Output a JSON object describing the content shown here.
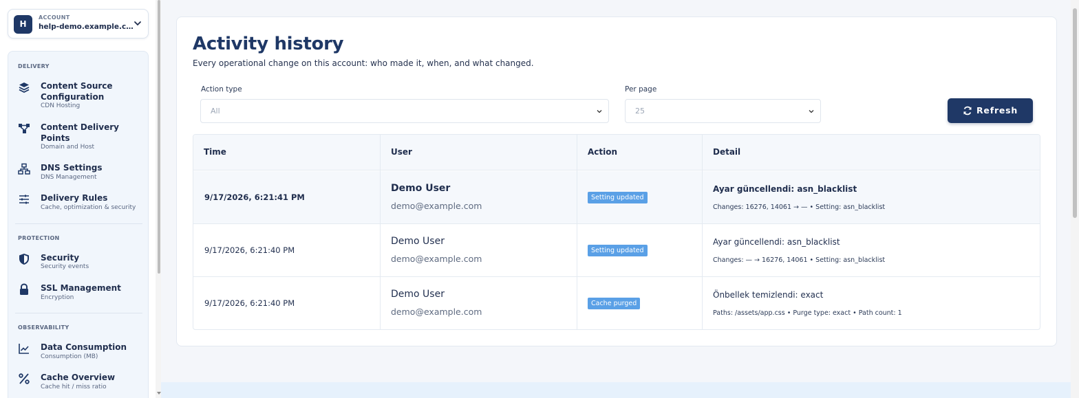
{
  "account": {
    "label": "ACCOUNT",
    "avatar_letter": "H",
    "name": "help-demo.example.c..."
  },
  "sidebar": {
    "sections": [
      {
        "title": "DELIVERY",
        "items": [
          {
            "label": "Content Source Configuration",
            "sub": "CDN Hosting",
            "icon": "layers-icon"
          },
          {
            "label": "Content Delivery Points",
            "sub": "Domain and Host",
            "icon": "network-nodes-icon"
          },
          {
            "label": "DNS Settings",
            "sub": "DNS Management",
            "icon": "sitemap-icon"
          },
          {
            "label": "Delivery Rules",
            "sub": "Cache, optimization & security",
            "icon": "sliders-icon"
          }
        ]
      },
      {
        "title": "PROTECTION",
        "items": [
          {
            "label": "Security",
            "sub": "Security events",
            "icon": "shield-icon"
          },
          {
            "label": "SSL Management",
            "sub": "Encryption",
            "icon": "lock-icon"
          }
        ]
      },
      {
        "title": "OBSERVABILITY",
        "items": [
          {
            "label": "Data Consumption",
            "sub": "Consumption (MB)",
            "icon": "line-chart-icon"
          },
          {
            "label": "Cache Overview",
            "sub": "Cache hit / miss ratio",
            "icon": "percent-icon"
          }
        ]
      }
    ]
  },
  "page": {
    "title": "Activity history",
    "subtitle": "Every operational change on this account: who made it, when, and what changed."
  },
  "filters": {
    "action_type_label": "Action type",
    "action_type_value": "All",
    "per_page_label": "Per page",
    "per_page_value": "25",
    "refresh_label": "Refresh"
  },
  "table": {
    "headers": [
      "Time",
      "User",
      "Action",
      "Detail"
    ],
    "rows": [
      {
        "time": "9/17/2026, 6:21:41 PM",
        "user": "Demo User",
        "email": "demo@example.com",
        "action": "Setting updated",
        "detail": "Ayar güncellendi: asn_blacklist",
        "changes": "Changes: 16276, 14061 → — • Setting: asn_blacklist"
      },
      {
        "time": "9/17/2026, 6:21:40 PM",
        "user": "Demo User",
        "email": "demo@example.com",
        "action": "Setting updated",
        "detail": "Ayar güncellendi: asn_blacklist",
        "changes": "Changes: — → 16276, 14061 • Setting: asn_blacklist"
      },
      {
        "time": "9/17/2026, 6:21:40 PM",
        "user": "Demo User",
        "email": "demo@example.com",
        "action": "Cache purged",
        "detail": "Önbellek temizlendi: exact",
        "changes": "Paths: /assets/app.css • Purge type: exact • Path count: 1"
      }
    ]
  },
  "colors": {
    "brand": "#1f3866",
    "badge": "#5aa0e6",
    "sidebar_panel": "#f1f6fc"
  }
}
